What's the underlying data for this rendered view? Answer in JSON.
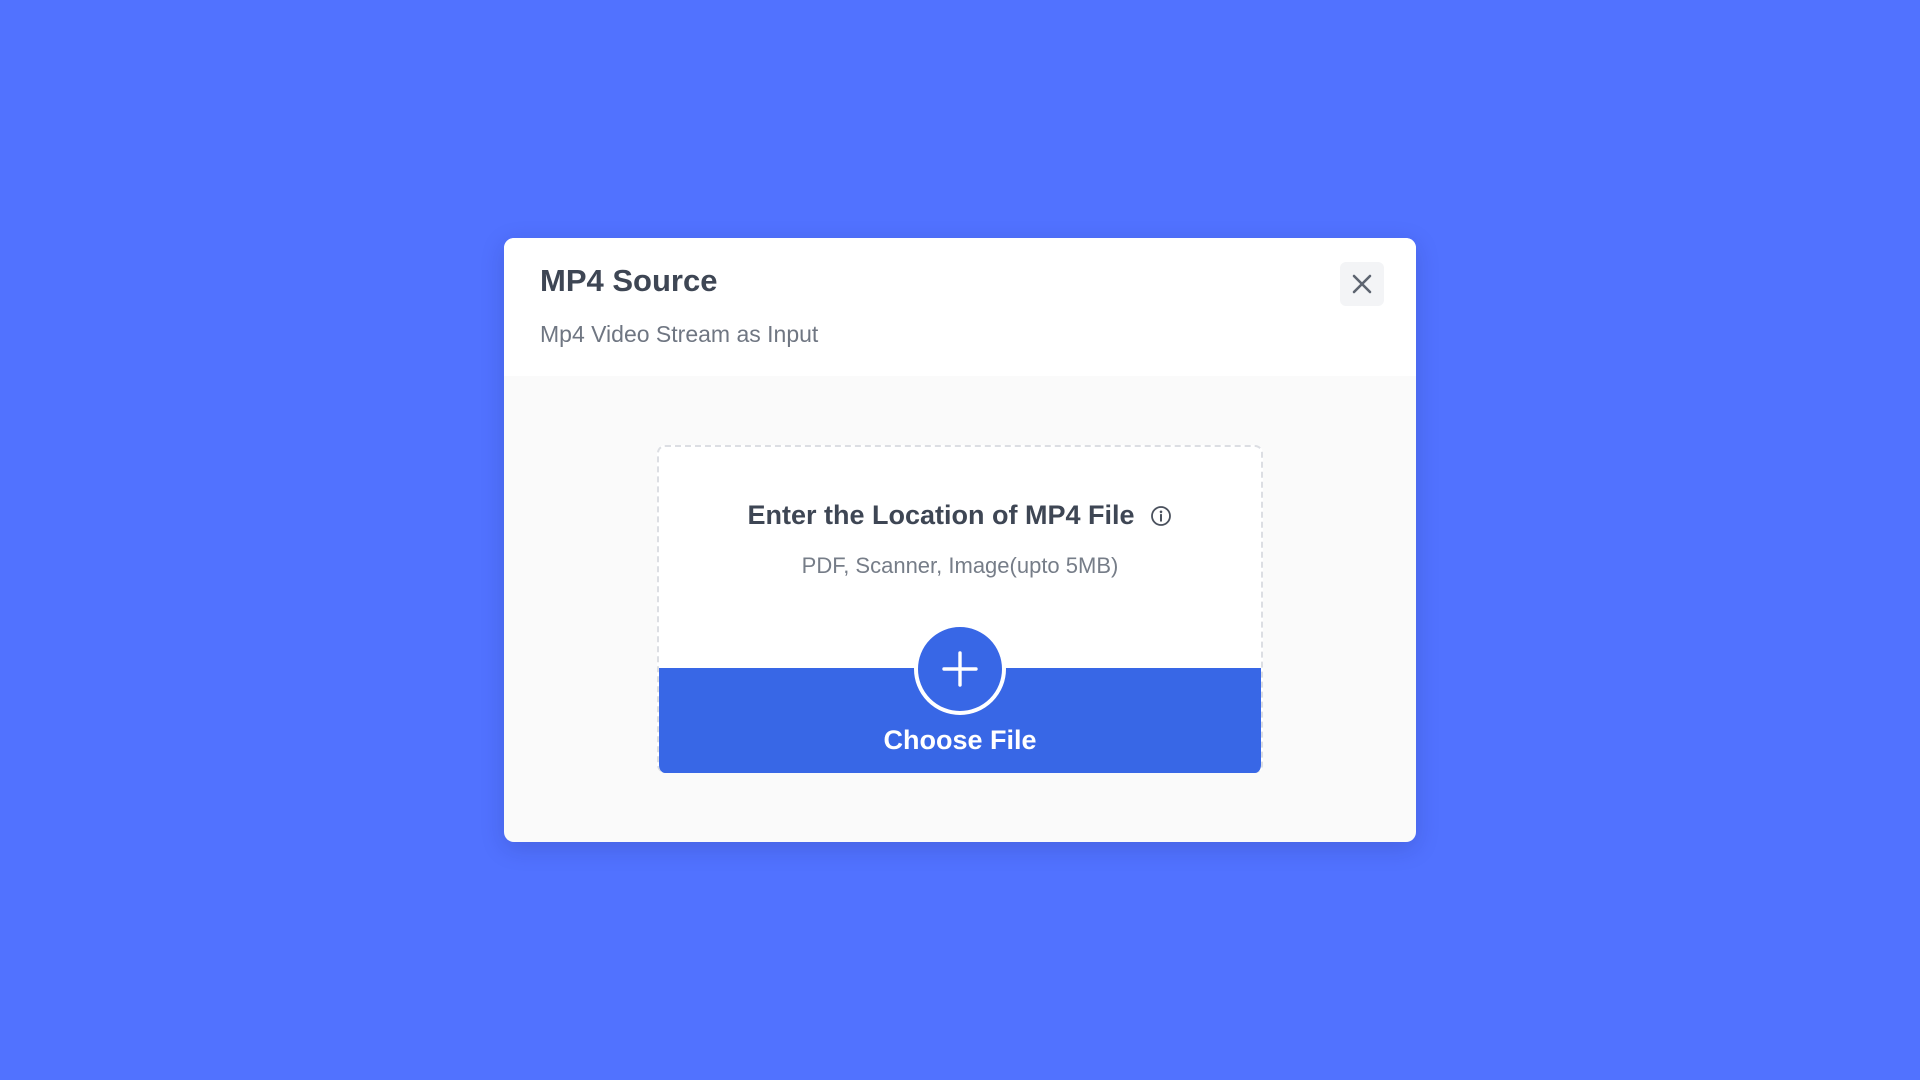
{
  "theme": {
    "page_background": "#5172ff",
    "accent": "#3867e6",
    "text_primary": "#3e4654",
    "text_secondary": "#6f7682"
  },
  "modal": {
    "title": "MP4 Source",
    "subtitle": "Mp4 Video Stream as Input",
    "close_icon": "close-icon"
  },
  "upload": {
    "title": "Enter the Location of MP4 File",
    "info_icon": "info-icon",
    "hint": "PDF, Scanner, Image(upto 5MB)",
    "add_icon": "plus-icon",
    "button_label": "Choose File"
  }
}
